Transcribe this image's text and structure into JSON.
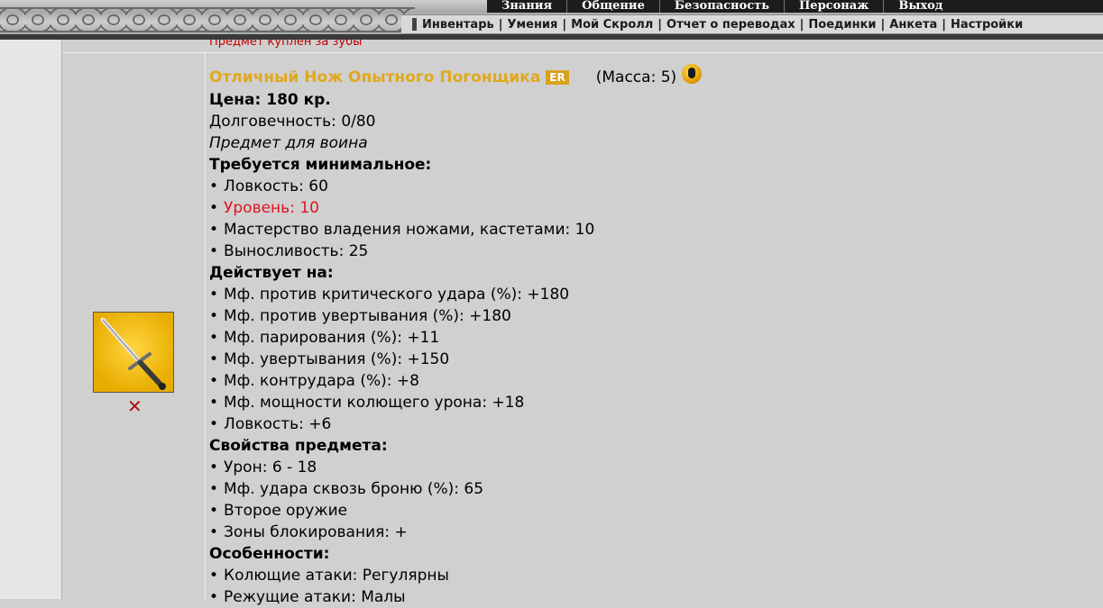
{
  "topmenu": [
    "Знания",
    "Общение",
    "Безопасность",
    "Персонаж",
    "Выход"
  ],
  "submenu": [
    "Инвентарь",
    "Умения",
    "Мой Скролл",
    "Отчет о переводах",
    "Поединки",
    "Анкета",
    "Настройки"
  ],
  "notice": "Предмет куплен за зубы",
  "item": {
    "name": "Отличный Нож Опытного Погонщика",
    "badge": "ER",
    "mass": "(Масса: 5)",
    "price": "Цена: 180 кр.",
    "durability": "Долговечность: 0/80",
    "class_note": "Предмет для воина",
    "requirements_title": "Требуется минимальное:",
    "requirements": [
      {
        "text": "Ловкость: 60",
        "red": false
      },
      {
        "text": "Уровень: 10",
        "red": true
      },
      {
        "text": "Мастерство владения ножами, кастетами: 10",
        "red": false
      },
      {
        "text": "Выносливость: 25",
        "red": false
      }
    ],
    "effects_title": "Действует на:",
    "effects": [
      "Мф. против критического удара (%): +180",
      "Мф. против увертывания (%): +180",
      "Мф. парирования (%): +11",
      "Мф. увертывания (%): +150",
      "Мф. контрудара (%): +8",
      "Мф. мощности колющего урона: +18",
      "Ловкость: +6"
    ],
    "properties_title": "Свойства предмета:",
    "properties": [
      "Урон: 6 - 18",
      "Мф. удара сквозь броню (%): 65",
      "Второе оружие",
      "Зоны блокирования: +"
    ],
    "features_title": "Особенности:",
    "features": [
      "Колющие атаки: Регулярны",
      "Режущие атаки: Малы"
    ]
  },
  "icons": {
    "item_image": "knife-icon",
    "remove": "remove-x-icon",
    "info": "info-icon"
  },
  "colors": {
    "item_name": "#e0a81c",
    "requirement_unmet": "#e0141e",
    "notice": "#c00000",
    "remove": "#b01010"
  }
}
